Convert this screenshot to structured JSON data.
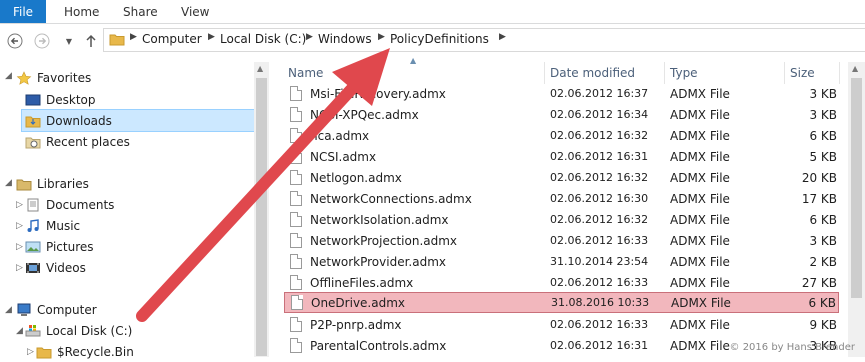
{
  "ribbon": {
    "tabs": [
      "File",
      "Home",
      "Share",
      "View"
    ]
  },
  "address": {
    "crumbs": [
      "Computer",
      "Local Disk (C:)",
      "Windows",
      "PolicyDefinitions"
    ]
  },
  "nav": {
    "favorites_label": "Favorites",
    "favorites": [
      "Desktop",
      "Downloads",
      "Recent places"
    ],
    "libraries_label": "Libraries",
    "libraries": [
      "Documents",
      "Music",
      "Pictures",
      "Videos"
    ],
    "computer_label": "Computer",
    "computer": [
      "Local Disk (C:)",
      "$Recycle.Bin"
    ]
  },
  "columns": {
    "name": "Name",
    "date": "Date modified",
    "type": "Type",
    "size": "Size"
  },
  "files": [
    {
      "name": "Msi-FileRecovery.admx",
      "date": "02.06.2012 16:37",
      "type": "ADMX File",
      "size": "3 KB"
    },
    {
      "name": "NCSI-XPQec.admx",
      "date": "02.06.2012 16:34",
      "type": "ADMX File",
      "size": "3 KB"
    },
    {
      "name": "nca.admx",
      "date": "02.06.2012 16:32",
      "type": "ADMX File",
      "size": "6 KB"
    },
    {
      "name": "NCSI.admx",
      "date": "02.06.2012 16:31",
      "type": "ADMX File",
      "size": "5 KB"
    },
    {
      "name": "Netlogon.admx",
      "date": "02.06.2012 16:32",
      "type": "ADMX File",
      "size": "20 KB"
    },
    {
      "name": "NetworkConnections.admx",
      "date": "02.06.2012 16:30",
      "type": "ADMX File",
      "size": "17 KB"
    },
    {
      "name": "NetworkIsolation.admx",
      "date": "02.06.2012 16:32",
      "type": "ADMX File",
      "size": "6 KB"
    },
    {
      "name": "NetworkProjection.admx",
      "date": "02.06.2012 16:33",
      "type": "ADMX File",
      "size": "3 KB"
    },
    {
      "name": "NetworkProvider.admx",
      "date": "31.10.2014 23:54",
      "type": "ADMX File",
      "size": "2 KB"
    },
    {
      "name": "OfflineFiles.admx",
      "date": "02.06.2012 16:33",
      "type": "ADMX File",
      "size": "27 KB"
    },
    {
      "name": "OneDrive.admx",
      "date": "31.08.2016 10:33",
      "type": "ADMX File",
      "size": "6 KB"
    },
    {
      "name": "P2P-pnrp.admx",
      "date": "02.06.2012 16:33",
      "type": "ADMX File",
      "size": "9 KB"
    },
    {
      "name": "ParentalControls.admx",
      "date": "02.06.2012 16:31",
      "type": "ADMX File",
      "size": "3 KB"
    }
  ],
  "highlighted_file": "OneDrive.admx",
  "copyright": "© 2016 by Hans Brender",
  "colors": {
    "file_tab": "#1979ca",
    "highlight": "#f2b7bd",
    "arrow": "#e0484d",
    "selected_nav": "#cce8ff"
  }
}
